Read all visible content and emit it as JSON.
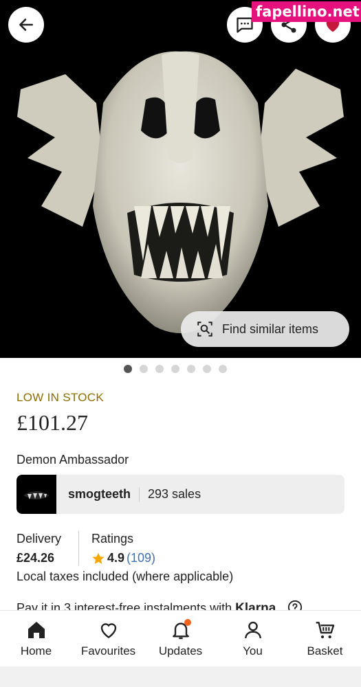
{
  "watermark": "fapellino.net",
  "hero": {
    "find_similar_label": "Find similar items",
    "image_count": 7,
    "active_index": 0
  },
  "listing": {
    "stock_status": "LOW IN STOCK",
    "price": "£101.27",
    "title": "Demon Ambassador"
  },
  "shop": {
    "name": "smogteeth",
    "sales": "293 sales"
  },
  "delivery": {
    "label": "Delivery",
    "value": "£24.26"
  },
  "ratings": {
    "label": "Ratings",
    "value": "4.9",
    "count": "(109)"
  },
  "taxes_note": "Local taxes included (where applicable)",
  "klarna": {
    "text": "Pay it in 3 interest-free instalments with ",
    "brand": "Klarna."
  },
  "nav": {
    "items": [
      {
        "label": "Home",
        "icon": "home-icon"
      },
      {
        "label": "Favourites",
        "icon": "heart-icon"
      },
      {
        "label": "Updates",
        "icon": "bell-icon"
      },
      {
        "label": "You",
        "icon": "person-icon"
      },
      {
        "label": "Basket",
        "icon": "cart-icon"
      }
    ]
  },
  "colors": {
    "watermark_bg": "#e5127d",
    "stock_text": "#8a6d00",
    "rating_count": "#3d6fb4",
    "favourite_heart": "#c4183c",
    "notification_dot": "#f1641e"
  }
}
